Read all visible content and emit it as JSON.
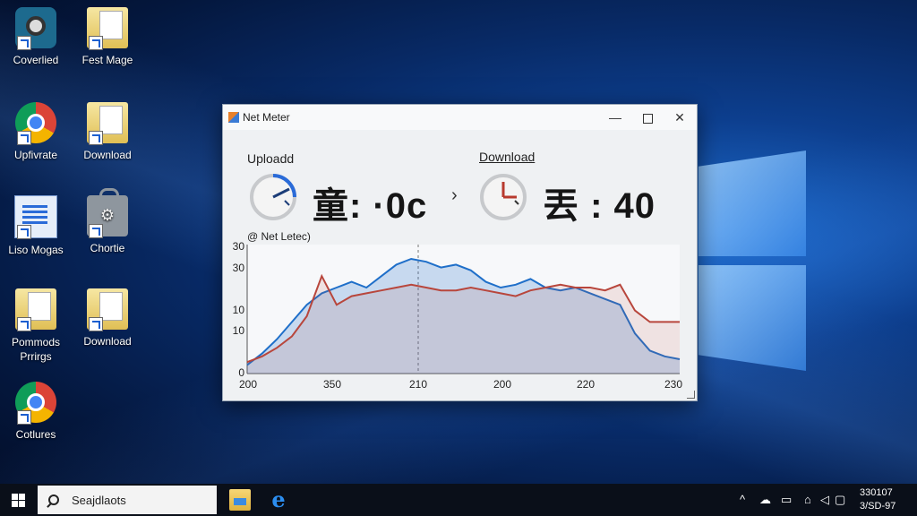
{
  "desktop": {
    "icons": [
      {
        "label": "Coverlied",
        "icon": "camera-app-icon"
      },
      {
        "label": "Fest Mage",
        "icon": "folder-icon"
      },
      {
        "label": "Upfivrate",
        "icon": "chrome-icon"
      },
      {
        "label": "Download",
        "icon": "folder-icon"
      },
      {
        "label": "Liso Mogas",
        "icon": "document-icon"
      },
      {
        "label": "Chortie",
        "icon": "bag-icon"
      },
      {
        "label": "Pommods Prrirgs",
        "icon": "folder-icon"
      },
      {
        "label": "Download",
        "icon": "folder-icon"
      },
      {
        "label": "Cotlures",
        "icon": "chrome-icon"
      }
    ]
  },
  "window": {
    "title": "Net Meter",
    "controls": {
      "minimize": "—",
      "close": "✕"
    },
    "upload": {
      "label": "Uploadd",
      "value": "童: ·0ᴄ"
    },
    "download": {
      "label": "Download",
      "value": "丟 : 40"
    },
    "chevron": "›",
    "legend_label": "@ Net Letec)"
  },
  "chart_data": {
    "type": "area",
    "x_tick_labels": [
      "200",
      "350",
      "210",
      "200",
      "220",
      "230"
    ],
    "y_tick_labels": [
      "30",
      "30",
      "10",
      "10",
      "0"
    ],
    "grid": false,
    "series": [
      {
        "color": "#1f6fc9",
        "values": [
          3,
          7,
          12,
          18,
          24,
          28,
          30,
          32,
          30,
          34,
          38,
          40,
          39,
          37,
          38,
          36,
          32,
          30,
          31,
          33,
          30,
          29,
          30,
          28,
          26,
          24,
          14,
          8,
          6,
          5
        ]
      },
      {
        "color": "#b8463c",
        "values": [
          4,
          6,
          9,
          13,
          20,
          34,
          24,
          27,
          28,
          29,
          30,
          31,
          30,
          29,
          29,
          30,
          29,
          28,
          27,
          29,
          30,
          31,
          30,
          30,
          29,
          31,
          22,
          18,
          18,
          18
        ]
      }
    ]
  },
  "taskbar": {
    "search_placeholder": "Seajdlaots",
    "tray": {
      "chevron": "^",
      "clock_time": "330107",
      "clock_date": "3/SD-97"
    }
  }
}
